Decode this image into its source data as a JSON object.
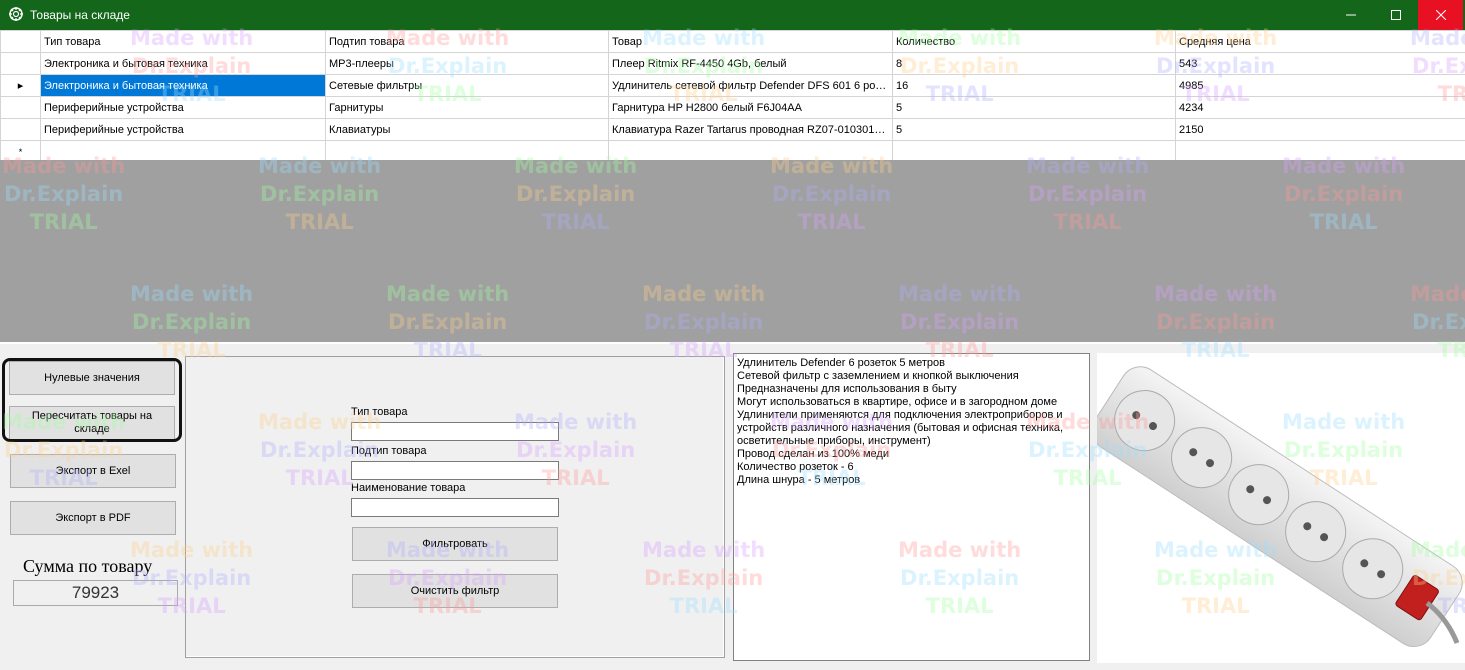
{
  "window": {
    "title": "Товары на складе",
    "icon": "gear-icon",
    "accent": "#13661a"
  },
  "grid": {
    "columns": [
      "Тип товара",
      "Подтип товара",
      "Товар",
      "Количество",
      "Средняя цена"
    ],
    "rows": [
      {
        "type": "Электроника и бытовая техника",
        "subtype": "МР3-плееры",
        "product": "Плеер Ritmix RF-4450 4Gb, белый",
        "qty": "8",
        "price": "543"
      },
      {
        "type": "Электроника и бытовая техника",
        "subtype": "Сетевые фильтры",
        "product": "Удлинитель сетевой фильтр Defender DFS 601 6 роз...",
        "qty": "16",
        "price": "4985"
      },
      {
        "type": "Периферийные устройства",
        "subtype": "Гарнитуры",
        "product": "Гарнитура HP H2800 белый F6J04AA",
        "qty": "5",
        "price": "4234"
      },
      {
        "type": "Периферийные устройства",
        "subtype": "Клавиатуры",
        "product": "Клавиатура Razer Tartarus проводная RZ07-0103010...",
        "qty": "5",
        "price": "2150"
      }
    ],
    "new_row_marker": "*",
    "current_row_marker": "▸"
  },
  "buttons": {
    "zero_values": "Нулевые значения",
    "recalc": "Пересчитать товары на складе",
    "export_excel": "Экспорт в Exel",
    "export_pdf": "Экспорт в PDF"
  },
  "sum": {
    "label": "Сумма по товару",
    "value": "79923"
  },
  "filter": {
    "type_label": "Тип товара",
    "subtype_label": "Подтип товара",
    "name_label": "Наименование товара",
    "filter_button": "Фильтровать",
    "clear_button": "Очистить фильтр"
  },
  "description": [
    "Удлинитель Defender 6 розеток 5 метров",
    "Сетевой фильтр с заземлением и кнопкой выключения",
    "Предназначены для использования в быту",
    "Могут использоваться в квартире, офисе и в загородном доме",
    "Удлинители применяются для подключения электроприборов и",
    "устройств различного назначения (бытовая и офисная техника,",
    "осветительные приборы, инструмент)",
    "Провод сделан из 100% меди",
    "Количество розеток - 6",
    "Длина шнура - 5 метров"
  ],
  "watermark": [
    "Made with",
    "Dr.Explain",
    "TRIAL"
  ]
}
